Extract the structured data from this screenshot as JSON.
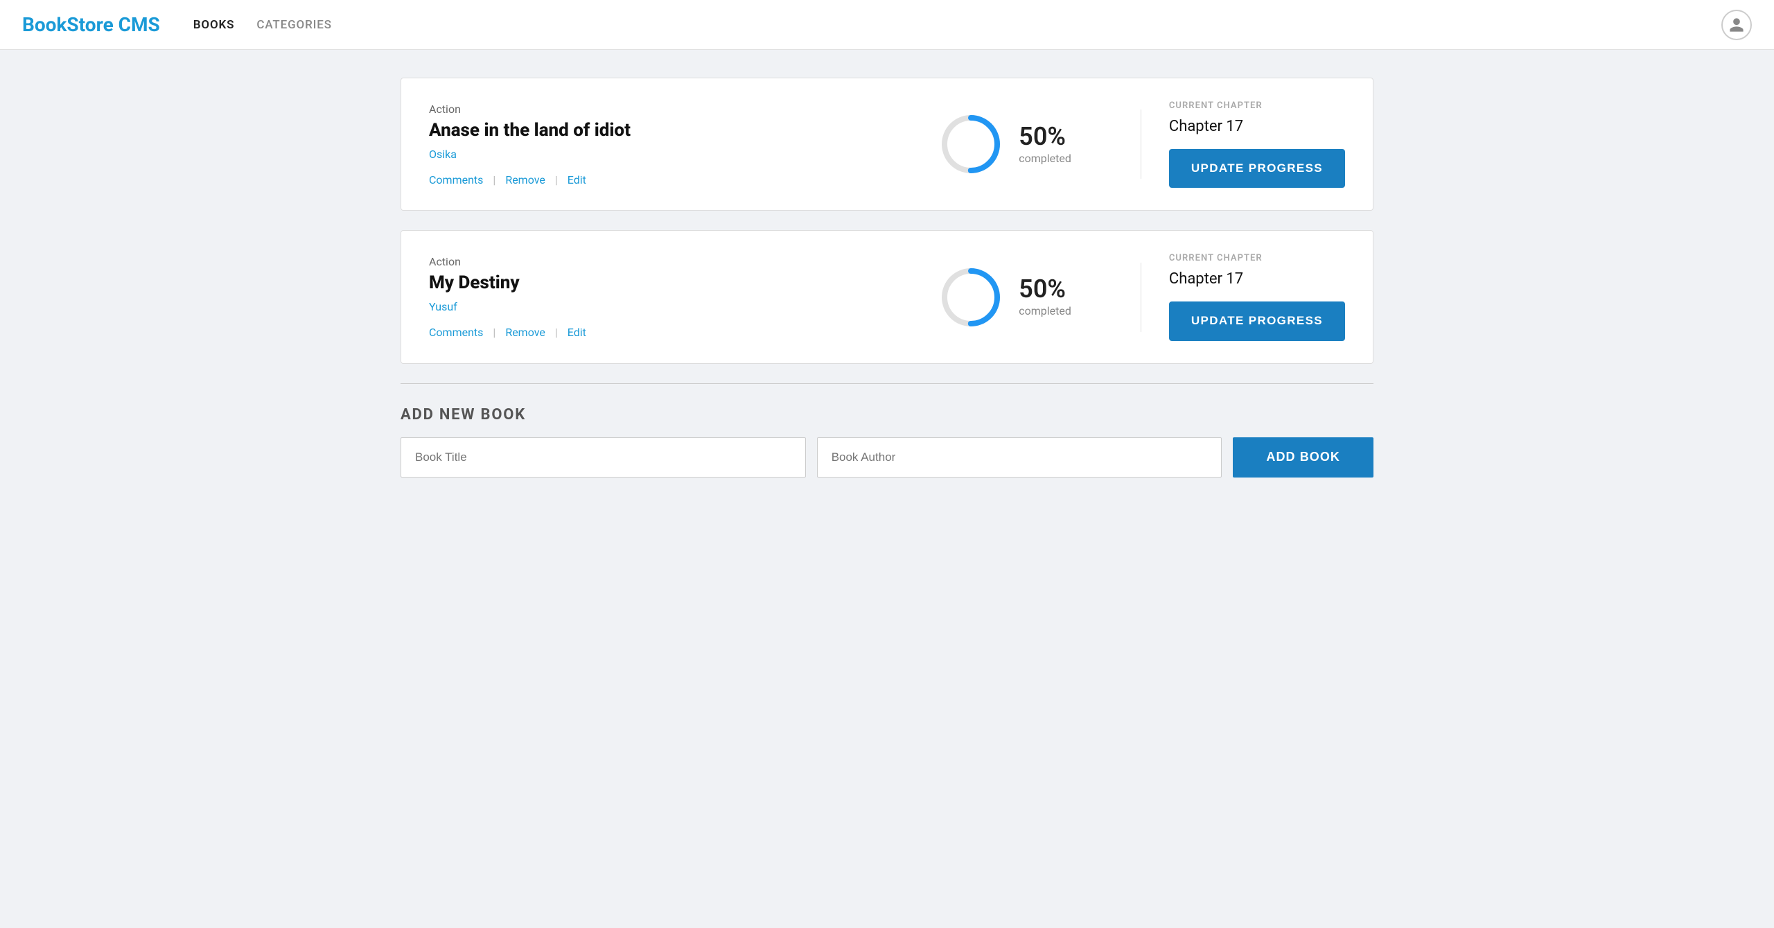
{
  "app": {
    "brand": "BookStore CMS"
  },
  "navbar": {
    "books_label": "BOOKS",
    "categories_label": "CATEGORIES"
  },
  "books": [
    {
      "id": "book-1",
      "genre": "Action",
      "title": "Anase in the land of idiot",
      "author": "Osika",
      "progress_percent": "50%",
      "progress_label": "completed",
      "current_chapter_label": "CURRENT CHAPTER",
      "current_chapter": "Chapter 17",
      "update_btn": "UPDATE PROGRESS",
      "actions": {
        "comments": "Comments",
        "remove": "Remove",
        "edit": "Edit"
      }
    },
    {
      "id": "book-2",
      "genre": "Action",
      "title": "My Destiny",
      "author": "Yusuf",
      "progress_percent": "50%",
      "progress_label": "completed",
      "current_chapter_label": "CURRENT CHAPTER",
      "current_chapter": "Chapter 17",
      "update_btn": "UPDATE PROGRESS",
      "actions": {
        "comments": "Comments",
        "remove": "Remove",
        "edit": "Edit"
      }
    }
  ],
  "add_new": {
    "title": "ADD NEW BOOK",
    "title_placeholder": "Book Title",
    "author_placeholder": "Book Author",
    "add_btn": "ADD BOOK"
  },
  "colors": {
    "brand_blue": "#1a9ad7",
    "btn_blue": "#1a7fc1",
    "progress_blue": "#2196f3",
    "progress_gray": "#e0e0e0"
  }
}
